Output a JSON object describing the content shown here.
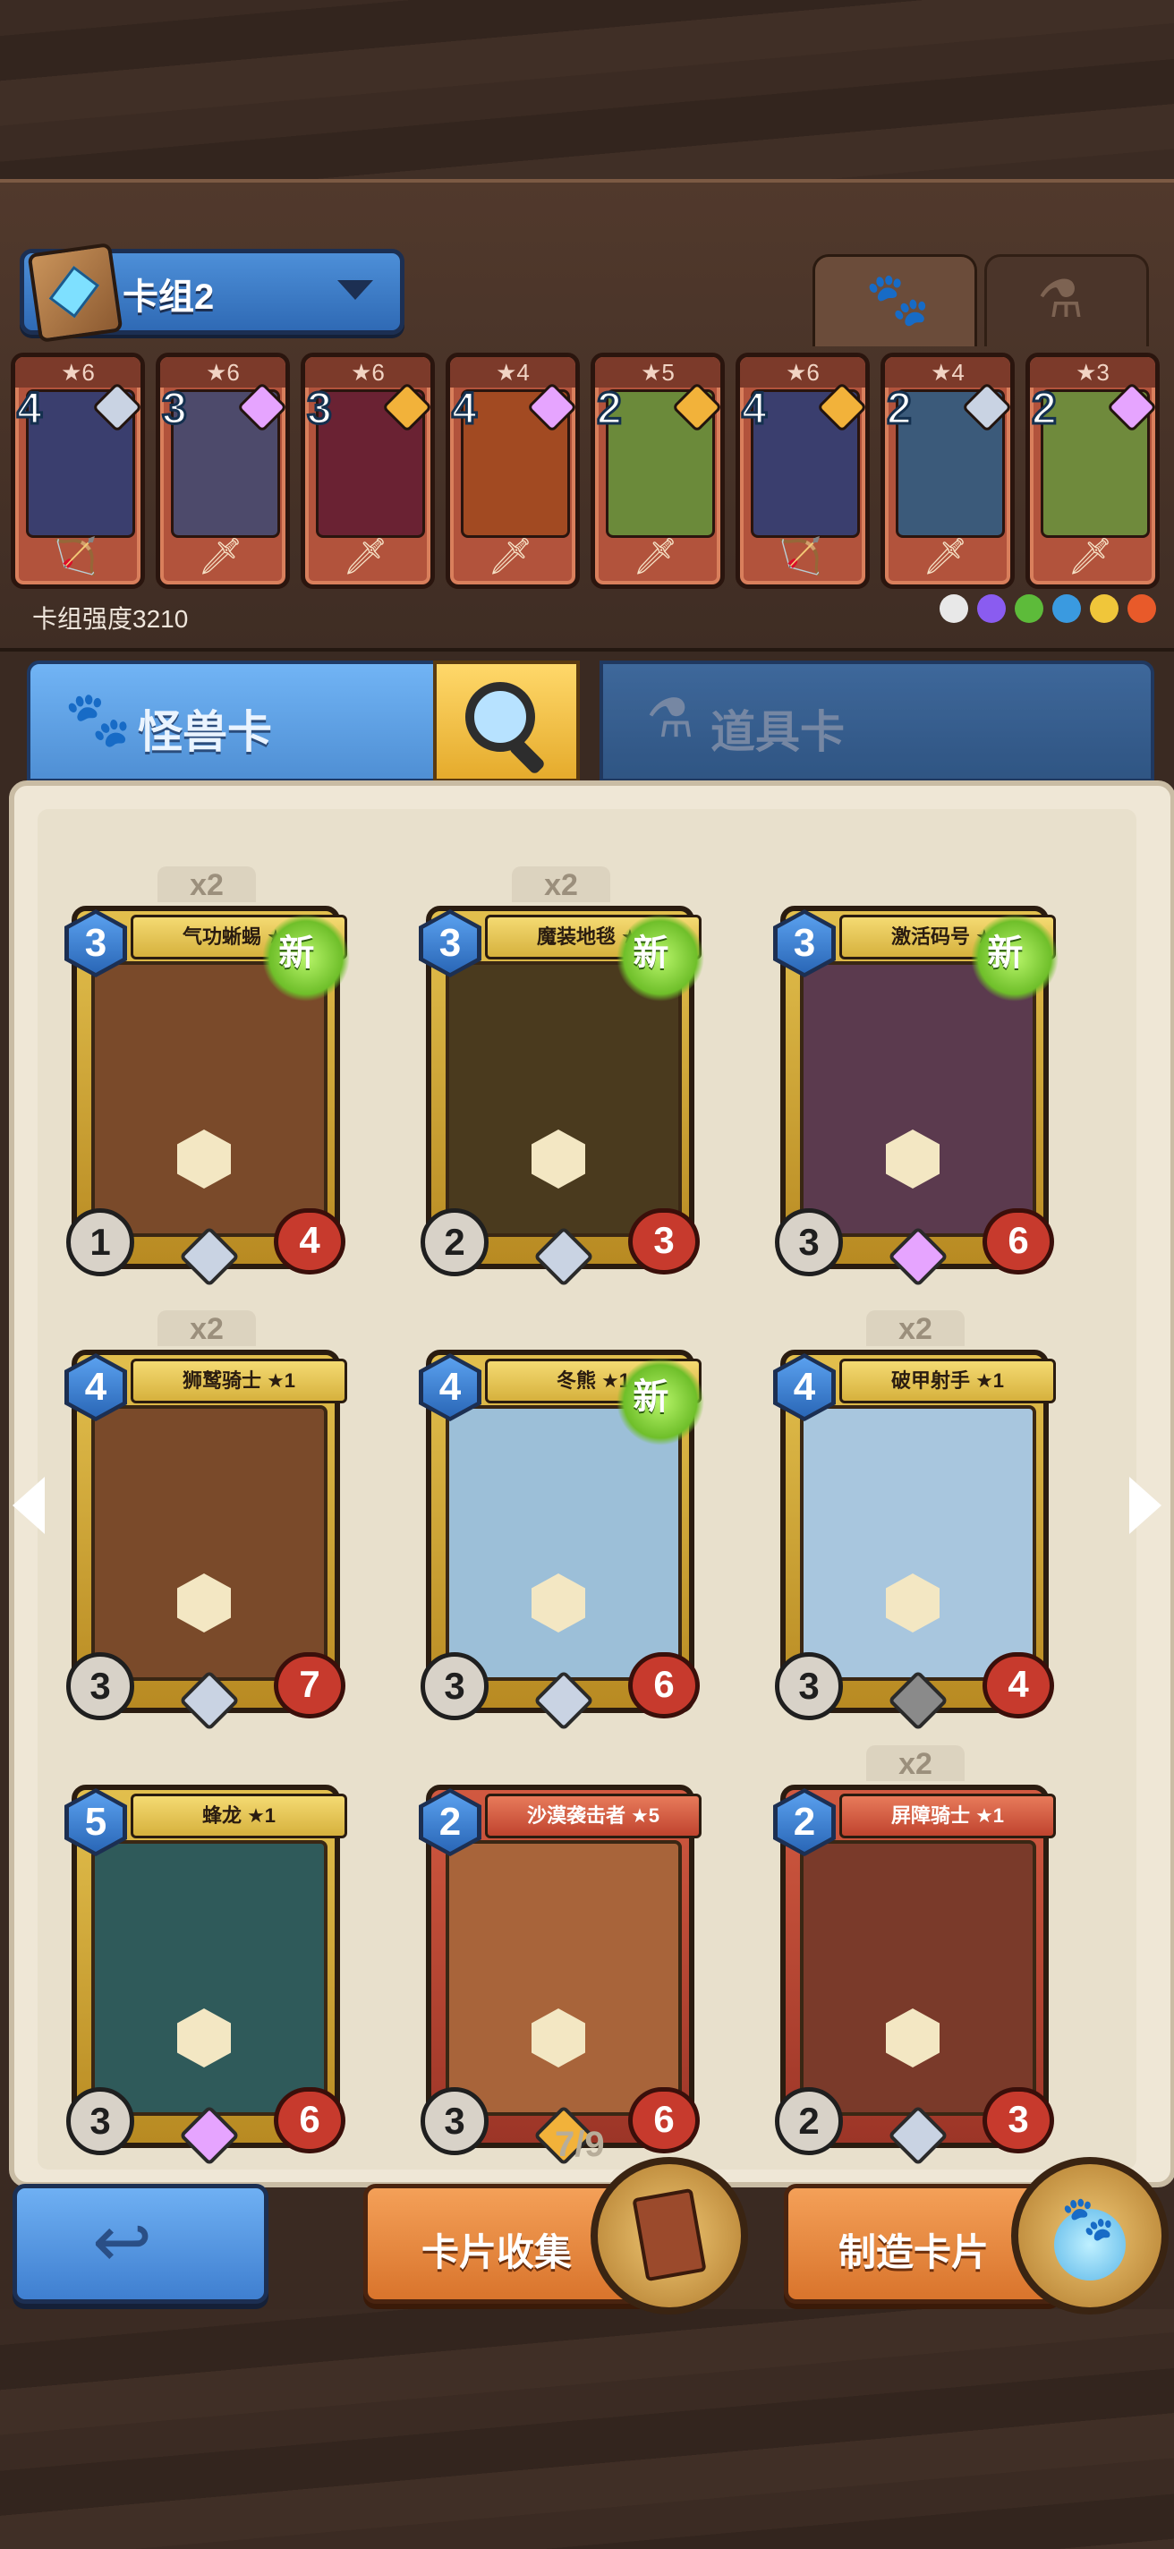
{
  "deck": {
    "name": "卡组2",
    "power_text": "卡组强度3210",
    "cards": [
      {
        "stars": "★6",
        "cost": "4",
        "gem": "#c9d3e3",
        "art": "#3a3e6e",
        "weapon": "🏹"
      },
      {
        "stars": "★6",
        "cost": "3",
        "gem": "#e6a4ff",
        "art": "#4d4a6b",
        "weapon": "🗡"
      },
      {
        "stars": "★6",
        "cost": "3",
        "gem": "#f2b23a",
        "art": "#6a2233",
        "weapon": "🗡"
      },
      {
        "stars": "★4",
        "cost": "4",
        "gem": "#e6a4ff",
        "art": "#a24a22",
        "weapon": "🗡"
      },
      {
        "stars": "★5",
        "cost": "2",
        "gem": "#f2b23a",
        "art": "#6b8a3a",
        "weapon": "🗡"
      },
      {
        "stars": "★6",
        "cost": "4",
        "gem": "#f2b23a",
        "art": "#3a3e6e",
        "weapon": "🏹"
      },
      {
        "stars": "★4",
        "cost": "2",
        "gem": "#c9d3e3",
        "art": "#3b5a7a",
        "weapon": "🗡"
      },
      {
        "stars": "★3",
        "cost": "2",
        "gem": "#e6a4ff",
        "art": "#6f8a3c",
        "weapon": "🗡"
      }
    ],
    "elements": [
      "#e8e8e8",
      "#8a5cf0",
      "#5dbb3a",
      "#3a9ae0",
      "#f0c63a",
      "#e85a2a"
    ]
  },
  "tabs": {
    "monster_label": "怪兽卡",
    "items_label": "道具卡",
    "paw_icon": "paw-icon",
    "potion_icon": "potion-icon"
  },
  "cards": [
    {
      "name": "气功蜥蜴 ★1",
      "cost": "3",
      "attack": "1",
      "hp": "4",
      "count": "x2",
      "is_new": "新",
      "art": "#7a4a2a",
      "rarity": "#c9d3e3",
      "frame": "gold"
    },
    {
      "name": "魔装地毯 ★1",
      "cost": "3",
      "attack": "2",
      "hp": "3",
      "count": "x2",
      "is_new": "新",
      "art": "#4a3a1e",
      "rarity": "#c9d3e3",
      "frame": "gold"
    },
    {
      "name": "激活码号 ★1",
      "cost": "3",
      "attack": "3",
      "hp": "6",
      "count": "",
      "is_new": "新",
      "art": "#5b3a4e",
      "rarity": "#e6a4ff",
      "frame": "gold"
    },
    {
      "name": "狮鹫骑士 ★1",
      "cost": "4",
      "attack": "3",
      "hp": "7",
      "count": "x2",
      "is_new": "",
      "art": "#7a4a2a",
      "rarity": "#c9d3e3",
      "frame": "gold"
    },
    {
      "name": "冬熊 ★1",
      "cost": "4",
      "attack": "3",
      "hp": "6",
      "count": "",
      "is_new": "新",
      "art": "#9cbfd8",
      "rarity": "#c9d3e3",
      "frame": "gold"
    },
    {
      "name": "破甲射手 ★1",
      "cost": "4",
      "attack": "3",
      "hp": "4",
      "count": "x2",
      "is_new": "",
      "art": "#a8c6de",
      "rarity": "#8a8a8a",
      "frame": "gold"
    },
    {
      "name": "蜂龙 ★1",
      "cost": "5",
      "attack": "3",
      "hp": "6",
      "count": "",
      "is_new": "",
      "art": "#2f5a5a",
      "rarity": "#e6a4ff",
      "frame": "gold"
    },
    {
      "name": "沙漠袭击者 ★5",
      "cost": "2",
      "attack": "3",
      "hp": "6",
      "count": "",
      "is_new": "",
      "art": "#a8643a",
      "rarity": "#f2b23a",
      "frame": "red"
    },
    {
      "name": "屏障骑士 ★1",
      "cost": "2",
      "attack": "2",
      "hp": "3",
      "count": "x2",
      "is_new": "",
      "art": "#7a3a2a",
      "rarity": "#c9d3e3",
      "frame": "red"
    }
  ],
  "pagination": {
    "text": "7/9"
  },
  "buttons": {
    "back_icon": "back-arrow-icon",
    "collect_label": "卡片收集",
    "craft_label": "制造卡片"
  }
}
